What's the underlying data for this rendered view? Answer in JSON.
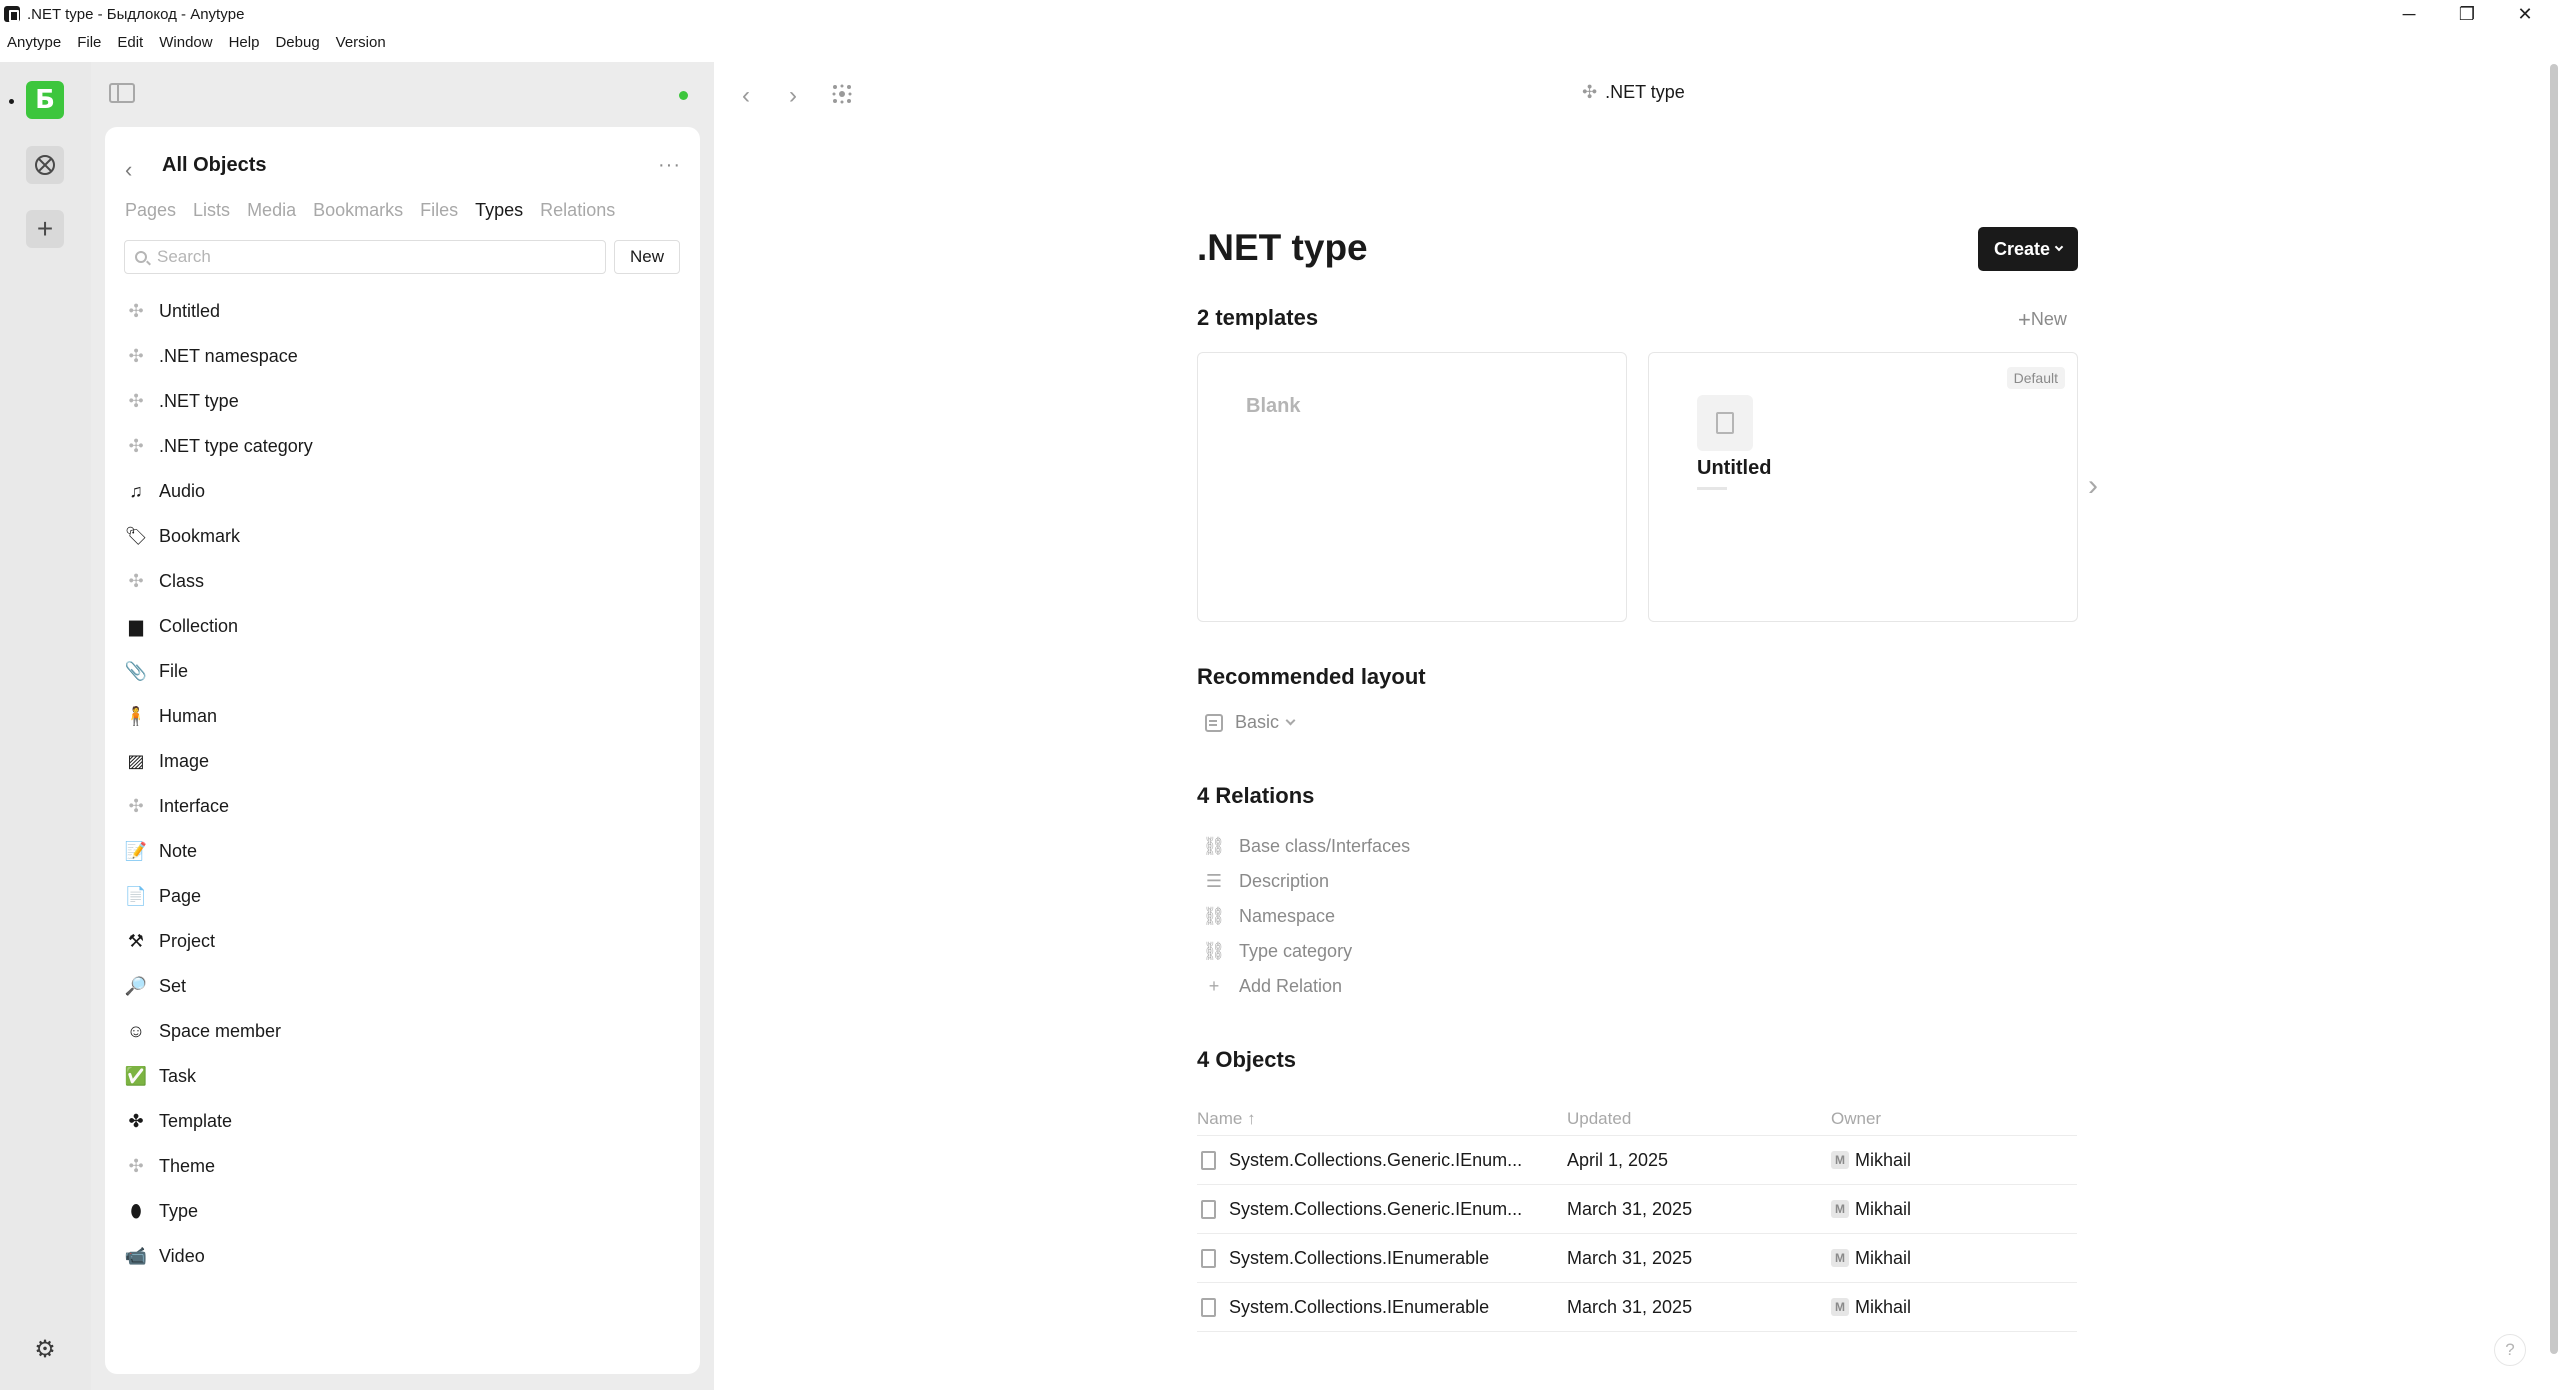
{
  "window": {
    "title": ".NET type - Быдлокод - Anytype",
    "minimize": "─",
    "maximize": "❐",
    "close": "✕"
  },
  "menubar": [
    "Anytype",
    "File",
    "Edit",
    "Window",
    "Help",
    "Debug",
    "Version"
  ],
  "vault": {
    "space_letter": "Б",
    "add_label": "+"
  },
  "sidebar": {
    "title": "All Objects",
    "tabs": [
      "Pages",
      "Lists",
      "Media",
      "Bookmarks",
      "Files",
      "Types",
      "Relations"
    ],
    "active_tab": "Types",
    "search_placeholder": "Search",
    "new_label": "New",
    "items": [
      {
        "label": "Untitled",
        "icon": "type-puzzle-icon",
        "glyph": "✣"
      },
      {
        "label": ".NET namespace",
        "icon": "type-puzzle-icon",
        "glyph": "✣"
      },
      {
        "label": ".NET type",
        "icon": "type-puzzle-icon",
        "glyph": "✣"
      },
      {
        "label": ".NET type category",
        "icon": "type-puzzle-icon",
        "glyph": "✣"
      },
      {
        "label": "Audio",
        "icon": "music-note-icon",
        "glyph": "♫"
      },
      {
        "label": "Bookmark",
        "icon": "bookmark-tag-icon",
        "glyph": "🏷"
      },
      {
        "label": "Class",
        "icon": "type-puzzle-icon",
        "glyph": "✣"
      },
      {
        "label": "Collection",
        "icon": "box-icon",
        "glyph": "▆"
      },
      {
        "label": "File",
        "icon": "paperclip-icon",
        "glyph": "📎"
      },
      {
        "label": "Human",
        "icon": "person-icon",
        "glyph": "🧍"
      },
      {
        "label": "Image",
        "icon": "picture-icon",
        "glyph": "▨"
      },
      {
        "label": "Interface",
        "icon": "type-puzzle-icon",
        "glyph": "✣"
      },
      {
        "label": "Note",
        "icon": "memo-icon",
        "glyph": "📝"
      },
      {
        "label": "Page",
        "icon": "page-icon",
        "glyph": "📄"
      },
      {
        "label": "Project",
        "icon": "hammer-icon",
        "glyph": "⚒"
      },
      {
        "label": "Set",
        "icon": "magnifier-icon",
        "glyph": "🔎"
      },
      {
        "label": "Space member",
        "icon": "face-icon",
        "glyph": "☺"
      },
      {
        "label": "Task",
        "icon": "checkmark-icon",
        "glyph": "✅"
      },
      {
        "label": "Template",
        "icon": "puzzle-piece-icon",
        "glyph": "✤"
      },
      {
        "label": "Theme",
        "icon": "type-puzzle-icon",
        "glyph": "✣"
      },
      {
        "label": "Type",
        "icon": "egg-icon",
        "glyph": "⬮"
      },
      {
        "label": "Video",
        "icon": "camera-icon",
        "glyph": "📹"
      }
    ]
  },
  "header": {
    "title": ".NET type"
  },
  "main": {
    "title": ".NET type",
    "create_label": "Create",
    "templates_title": "2 templates",
    "new_template_label": "New",
    "templates": {
      "blank_label": "Blank",
      "default_badge": "Default",
      "untitled_label": "Untitled"
    },
    "layout_title": "Recommended layout",
    "layout_value": "Basic",
    "relations_title": "4 Relations",
    "relations": [
      {
        "label": "Base class/Interfaces",
        "icon": "link-object-icon",
        "glyph": "⛓"
      },
      {
        "label": "Description",
        "icon": "text-lines-icon",
        "glyph": "☰"
      },
      {
        "label": "Namespace",
        "icon": "link-object-icon",
        "glyph": "⛓"
      },
      {
        "label": "Type category",
        "icon": "link-object-icon",
        "glyph": "⛓"
      },
      {
        "label": "Add Relation",
        "icon": "plus-icon",
        "glyph": "+"
      }
    ],
    "objects_title": "4 Objects",
    "objects_headers": {
      "name": "Name ↑",
      "updated": "Updated",
      "owner": "Owner"
    },
    "objects": [
      {
        "name": "System.Collections.Generic.IEnum...",
        "updated": "April 1, 2025",
        "owner": "Mikhail",
        "owner_initial": "M"
      },
      {
        "name": "System.Collections.Generic.IEnum...",
        "updated": "March 31, 2025",
        "owner": "Mikhail",
        "owner_initial": "M"
      },
      {
        "name": "System.Collections.IEnumerable",
        "updated": "March 31, 2025",
        "owner": "Mikhail",
        "owner_initial": "M"
      },
      {
        "name": "System.Collections.IEnumerable",
        "updated": "March 31, 2025",
        "owner": "Mikhail",
        "owner_initial": "M"
      }
    ]
  },
  "help_label": "?",
  "colors": {
    "accent": "#3dc63d",
    "dark_button": "#1a1a1a",
    "muted_text": "#8a8a8a"
  }
}
